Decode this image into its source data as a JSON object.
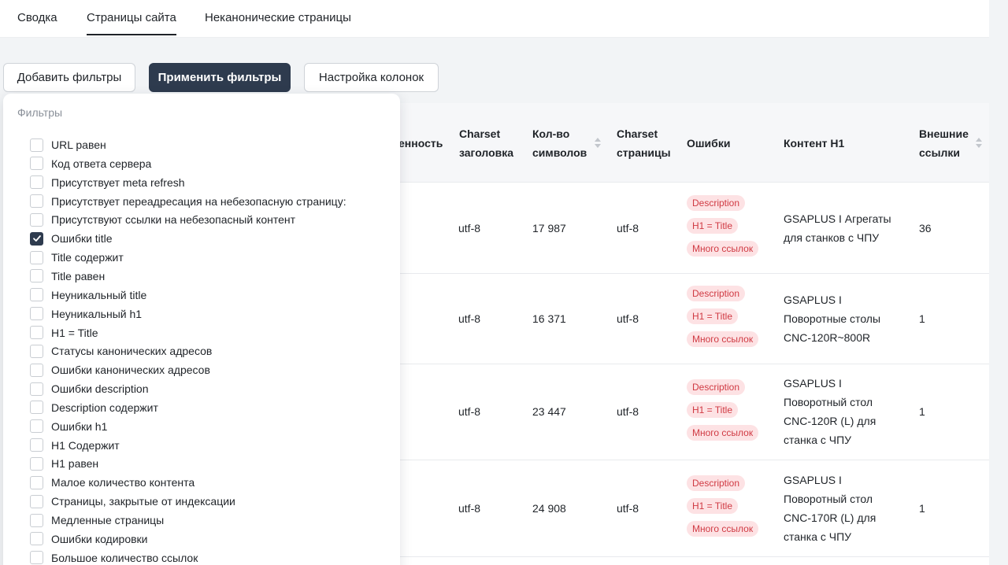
{
  "tabs": [
    {
      "label": "Сводка"
    },
    {
      "label": "Страницы сайта"
    },
    {
      "label": "Неканонические страницы"
    }
  ],
  "toolbar": {
    "add_filters": "Добавить фильтры",
    "apply_filters": "Применить фильтры",
    "columns_settings": "Настройка колонок"
  },
  "filters": {
    "title": "Фильтры",
    "items": [
      {
        "label": "URL равен",
        "checked": false
      },
      {
        "label": "Код ответа сервера",
        "checked": false
      },
      {
        "label": "Присутствует meta refresh",
        "checked": false
      },
      {
        "label": "Присутствует переадресация на небезопасную страницу:",
        "checked": false
      },
      {
        "label": "Присутствуют ссылки на небезопасный контент",
        "checked": false
      },
      {
        "label": "Ошибки title",
        "checked": true
      },
      {
        "label": "Title содержит",
        "checked": false
      },
      {
        "label": "Title равен",
        "checked": false
      },
      {
        "label": "Неуникальный title",
        "checked": false
      },
      {
        "label": "Неуникальный h1",
        "checked": false
      },
      {
        "label": "H1 = Title",
        "checked": false
      },
      {
        "label": "Статусы канонических адресов",
        "checked": false
      },
      {
        "label": "Ошибки канонических адресов",
        "checked": false
      },
      {
        "label": "Ошибки description",
        "checked": false
      },
      {
        "label": "Description содержит",
        "checked": false
      },
      {
        "label": "Ошибки h1",
        "checked": false
      },
      {
        "label": "H1 Содержит",
        "checked": false
      },
      {
        "label": "H1 равен",
        "checked": false
      },
      {
        "label": "Малое количество контента",
        "checked": false
      },
      {
        "label": "Страницы, закрытые от индексации",
        "checked": false
      },
      {
        "label": "Медленные страницы",
        "checked": false
      },
      {
        "label": "Ошибки кодировки",
        "checked": false
      },
      {
        "label": "Большое количество ссылок",
        "checked": false
      }
    ]
  },
  "table": {
    "headers": {
      "partial": "енность",
      "charset_title_1": "Charset",
      "charset_title_2": "заголовка",
      "chars_1": "Кол-во",
      "chars_2": "символов",
      "charset_page_1": "Charset",
      "charset_page_2": "страницы",
      "errors": "Ошибки",
      "h1": "Контент H1",
      "external_1": "Внешние",
      "external_2": "ссылки"
    },
    "rows": [
      {
        "charset_title": "utf-8",
        "chars": "17 987",
        "charset_page": "utf-8",
        "errors": [
          "Description",
          "H1 = Title",
          "Много ссылок"
        ],
        "h1": [
          "GSAPLUS I Агрегаты",
          "для станков с ЧПУ"
        ],
        "external": "36"
      },
      {
        "charset_title": "utf-8",
        "chars": "16 371",
        "charset_page": "utf-8",
        "errors": [
          "Description",
          "H1 = Title",
          "Много ссылок"
        ],
        "h1": [
          "GSAPLUS I",
          "Поворотные столы",
          "CNC-120R~800R"
        ],
        "external": "1"
      },
      {
        "charset_title": "utf-8",
        "chars": "23 447",
        "charset_page": "utf-8",
        "errors": [
          "Description",
          "H1 = Title",
          "Много ссылок"
        ],
        "h1": [
          "GSAPLUS I",
          "Поворотный стол",
          "CNC-120R (L) для",
          "станка с ЧПУ"
        ],
        "external": "1"
      },
      {
        "charset_title": "utf-8",
        "chars": "24 908",
        "charset_page": "utf-8",
        "errors": [
          "Description",
          "H1 = Title",
          "Много ссылок"
        ],
        "h1": [
          "GSAPLUS I",
          "Поворотный стол",
          "CNC-170R (L) для",
          "станка с ЧПУ"
        ],
        "external": "1"
      }
    ]
  },
  "colors": {
    "primary": "#2e3b4e",
    "badge_bg": "#fde2e4",
    "badge_text": "#d03a43"
  }
}
